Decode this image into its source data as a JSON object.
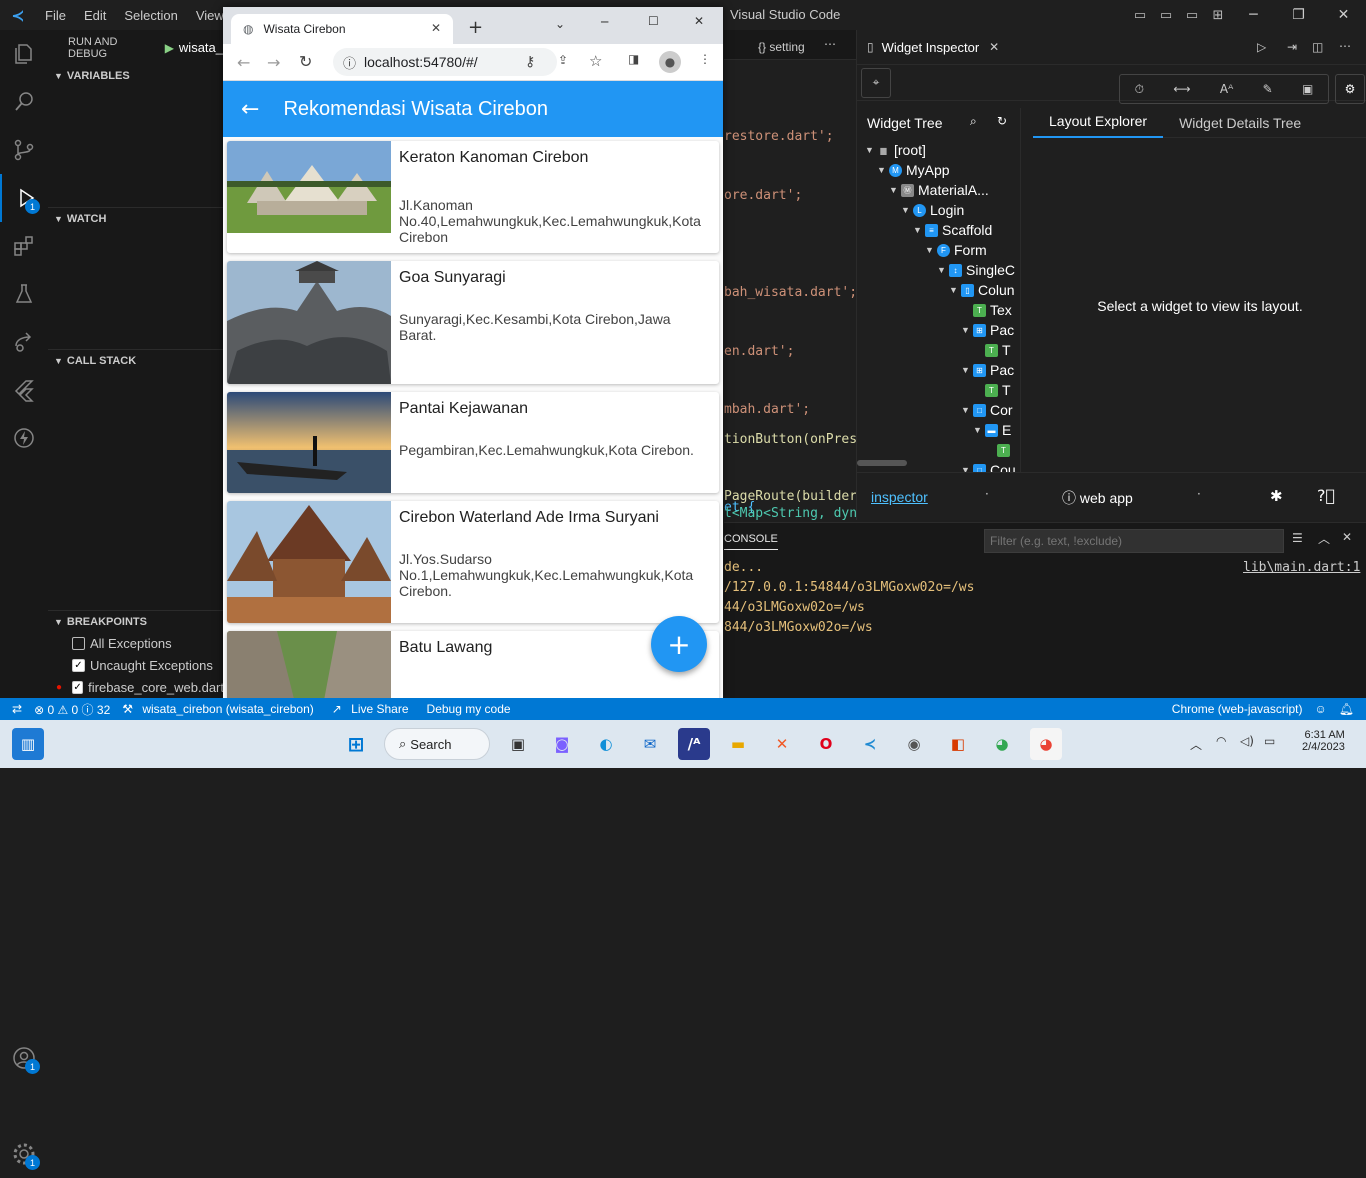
{
  "vscode": {
    "menu": [
      "File",
      "Edit",
      "Selection",
      "View"
    ],
    "title": "Visual Studio Code",
    "run_and_debug": "RUN AND DEBUG",
    "config": "wisata_",
    "settings_tab": "{} setting",
    "activity_badge_debug": "1",
    "activity_badge_account": "1",
    "activity_badge_settings": "1",
    "sections": {
      "variables": "VARIABLES",
      "watch": "WATCH",
      "call_stack": "CALL STACK",
      "breakpoints": "BREAKPOINTS"
    },
    "breakpoints": [
      {
        "label": "All Exceptions",
        "checked": false
      },
      {
        "label": "Uncaught Exceptions",
        "checked": true
      },
      {
        "label": "firebase_core_web.dart",
        "checked": true
      }
    ],
    "code_lines": [
      "restore.dart';",
      "ore.dart';",
      "",
      "bah_wisata.dart';",
      "en.dart';",
      "mbah.dart';",
      "",
      "et {"
    ],
    "code_lines2": [
      "tionButton(onPress",
      "PageRoute(builder:"
    ],
    "code_line3": "t<Map<String, dyna",
    "console_tab": "CONSOLE",
    "filter_placeholder": "Filter (e.g. text, !exclude)",
    "console_link": "lib\\main.dart:1",
    "console_lines": [
      "de...",
      "/127.0.0.1:54844/o3LMGoxw02o=/ws",
      "44/o3LMGoxw02o=/ws",
      "",
      "844/o3LMGoxw02o=/ws"
    ]
  },
  "inspector": {
    "tab_title": "Widget Inspector",
    "widget_tree": "Widget Tree",
    "layout_explorer": "Layout Explorer",
    "widget_details_tree": "Widget Details Tree",
    "select_message": "Select a widget to view its layout.",
    "footer_link": "inspector",
    "footer_app": "web app",
    "tree": [
      {
        "label": "[root]",
        "indent": 0,
        "icon": "folder"
      },
      {
        "label": "MyApp",
        "indent": 1,
        "icon": "M"
      },
      {
        "label": "MaterialA...",
        "indent": 2,
        "icon": "Ⓜ"
      },
      {
        "label": "Login",
        "indent": 3,
        "icon": "L"
      },
      {
        "label": "Scaffold",
        "indent": 4,
        "icon": "≡"
      },
      {
        "label": "Form",
        "indent": 5,
        "icon": "F"
      },
      {
        "label": "SingleC",
        "indent": 6,
        "icon": "↕"
      },
      {
        "label": "Colun",
        "indent": 7,
        "icon": "▯"
      },
      {
        "label": "Tex",
        "indent": 8,
        "icon": "T"
      },
      {
        "label": "Pac",
        "indent": 8,
        "icon": "⊞"
      },
      {
        "label": "T",
        "indent": 9,
        "icon": "T"
      },
      {
        "label": "Pac",
        "indent": 8,
        "icon": "⊞"
      },
      {
        "label": "T",
        "indent": 9,
        "icon": "T"
      },
      {
        "label": "Cor",
        "indent": 8,
        "icon": "□"
      },
      {
        "label": "E",
        "indent": 9,
        "icon": "▬"
      },
      {
        "label": "",
        "indent": 10,
        "icon": "T"
      },
      {
        "label": "Cou",
        "indent": 8,
        "icon": "□"
      }
    ]
  },
  "browser": {
    "tab_title": "Wisata Cirebon",
    "url": "localhost:54780/#/",
    "app_title": "Rekomendasi Wisata Cirebon",
    "items": [
      {
        "name": "Keraton Kanoman Cirebon",
        "address": "Jl.Kanoman No.40,Lemahwungkuk,Kec.Lemahwungkuk,Kota Cirebon"
      },
      {
        "name": "Goa Sunyaragi",
        "address": "Sunyaragi,Kec.Kesambi,Kota Cirebon,Jawa Barat."
      },
      {
        "name": "Pantai Kejawanan",
        "address": "Pegambiran,Kec.Lemahwungkuk,Kota Cirebon."
      },
      {
        "name": "Cirebon Waterland Ade Irma Suryani",
        "address": "Jl.Yos.Sudarso No.1,Lemahwungkuk,Kec.Lemahwungkuk,Kota Cirebon."
      },
      {
        "name": "Batu Lawang",
        "address": ""
      }
    ],
    "fab": "+"
  },
  "statusbar": {
    "problems": "⊗ 0 ⚠ 0 ⓘ 32",
    "project": "wisata_cirebon (wisata_cirebon)",
    "live_share": "Live Share",
    "debug_mode": "Debug my code",
    "device": "Chrome (web-javascript)"
  },
  "taskbar": {
    "search": "Search",
    "time": "6:31 AM",
    "date": "2/4/2023"
  }
}
